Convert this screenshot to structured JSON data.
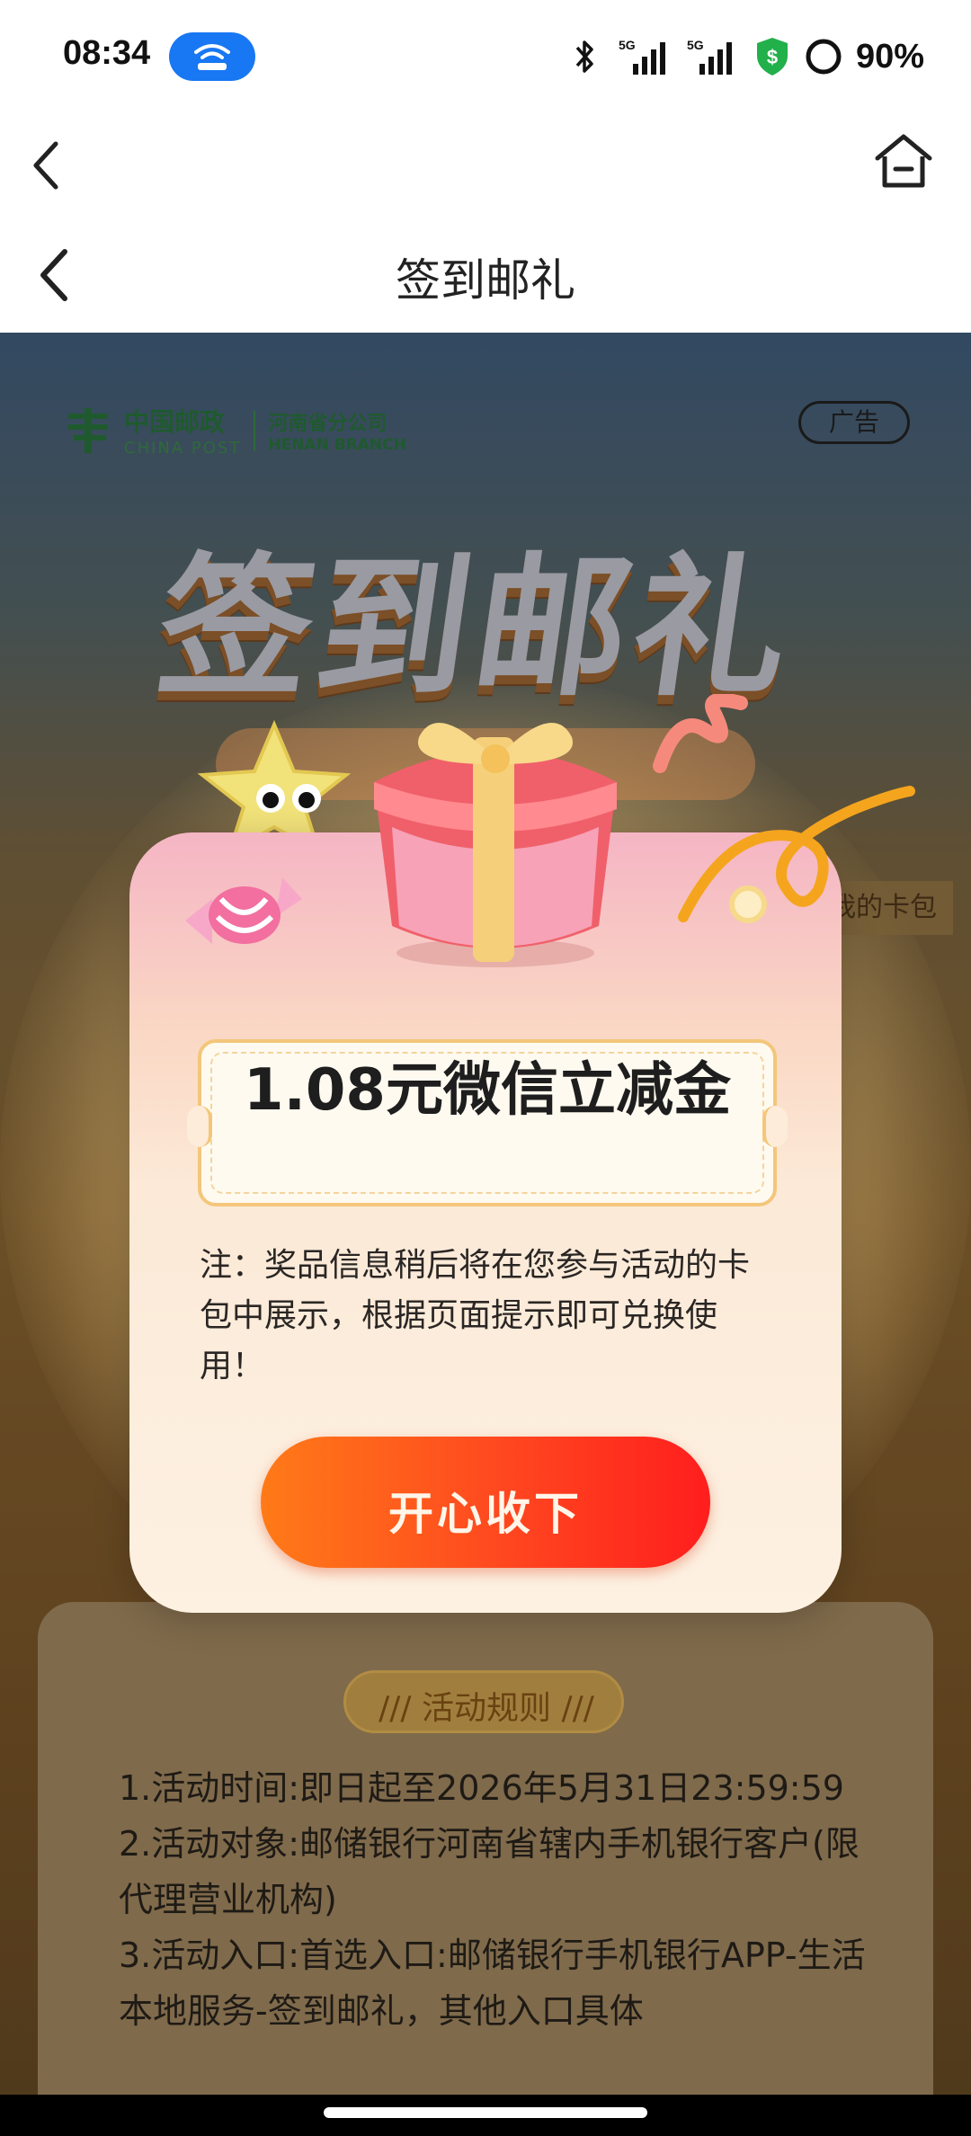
{
  "status_bar": {
    "time": "08:34",
    "network": "5G",
    "battery": "90%",
    "icons": [
      "hotspot-icon",
      "bluetooth-icon",
      "signal-5g-icon",
      "signal-5g-icon",
      "security-shield-icon",
      "battery-ring-icon"
    ]
  },
  "nav": {
    "title": "签到邮礼"
  },
  "banner": {
    "brand_cn": "中国邮政",
    "brand_en": "CHINA POST",
    "branch_cn": "河南省分公司",
    "branch_en": "HENAN BRANCH",
    "ad_label": "广告",
    "title": "签到邮礼",
    "card_link": "我的卡包"
  },
  "modal": {
    "prize": "1.08元微信立减金",
    "note": "注：奖品信息稍后将在您参与活动的卡包中展示，根据页面提示即可兑换使用！",
    "accept_label": "开心收下"
  },
  "rules": {
    "title": "活动规则",
    "lines": [
      "1.活动时间:即日起至2026年5月31日23:59:59",
      "2.活动对象:邮储银行河南省辖内手机银行客户(限代理营业机构)",
      "3.活动入口:首选入口:邮储银行手机银行APP-生活本地服务-签到邮礼，其他入口具体"
    ]
  },
  "colors": {
    "accent_blue": "#1877f2",
    "button_orange": "#ff7a18",
    "button_red": "#ff1e1e",
    "brand_green": "#1f5a2e"
  }
}
